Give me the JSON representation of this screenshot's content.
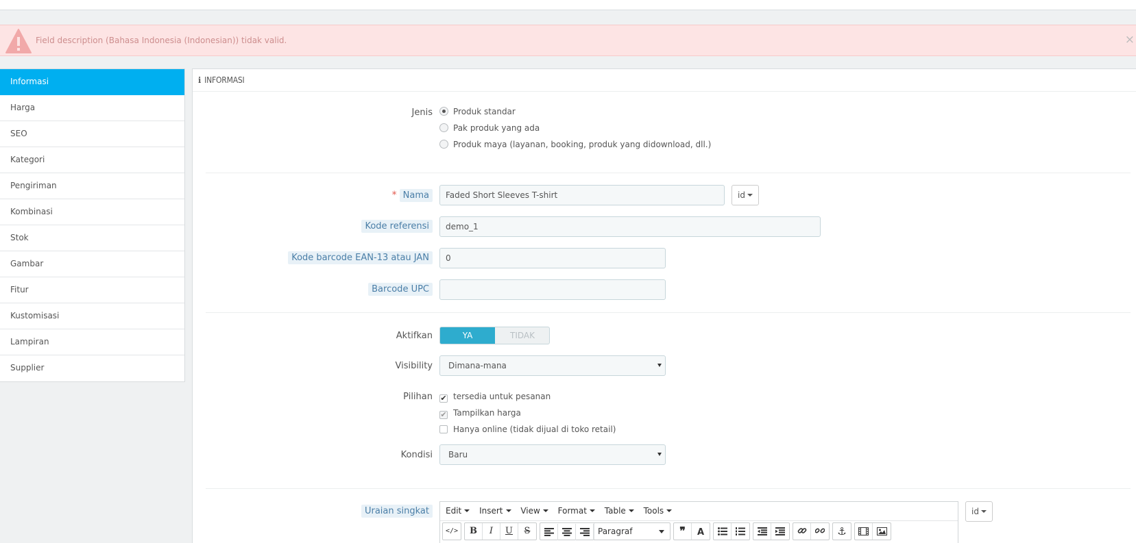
{
  "alert": {
    "message": "Field description (Bahasa Indonesia (Indonesian)) tidak valid.",
    "close": "×"
  },
  "sidebar": {
    "items": [
      {
        "label": "Informasi"
      },
      {
        "label": "Harga"
      },
      {
        "label": "SEO"
      },
      {
        "label": "Kategori"
      },
      {
        "label": "Pengiriman"
      },
      {
        "label": "Kombinasi"
      },
      {
        "label": "Stok"
      },
      {
        "label": "Gambar"
      },
      {
        "label": "Fitur"
      },
      {
        "label": "Kustomisasi"
      },
      {
        "label": "Lampiran"
      },
      {
        "label": "Supplier"
      }
    ],
    "active_index": 0
  },
  "panel": {
    "icon": "ℹ",
    "title": "INFORMASI"
  },
  "form": {
    "jenis": {
      "label": "Jenis",
      "options": [
        "Produk standar",
        "Pak produk yang ada",
        "Produk maya (layanan, booking, produk yang didownload, dll.)"
      ],
      "selected": 0
    },
    "nama": {
      "required_mark": "*",
      "label": "Nama",
      "value": "Faded Short Sleeves T-shirt",
      "lang": "id"
    },
    "kode_referensi": {
      "label": "Kode referensi",
      "value": "demo_1"
    },
    "ean13": {
      "label": "Kode barcode EAN-13 atau JAN",
      "value": "0"
    },
    "upc": {
      "label": "Barcode UPC",
      "value": ""
    },
    "aktifkan": {
      "label": "Aktifkan",
      "yes": "YA",
      "no": "TIDAK",
      "value": true
    },
    "visibility": {
      "label": "Visibility",
      "value": "Dimana-mana"
    },
    "pilihan": {
      "label": "Pilihan",
      "options": [
        {
          "label": "tersedia untuk pesanan",
          "checked": true
        },
        {
          "label": "Tampilkan harga",
          "checked": true
        },
        {
          "label": "Hanya online (tidak dijual di toko retail)",
          "checked": false
        }
      ]
    },
    "kondisi": {
      "label": "Kondisi",
      "value": "Baru"
    },
    "uraian_singkat": {
      "label": "Uraian singkat",
      "lang": "id"
    }
  },
  "editor": {
    "menus": [
      "Edit",
      "Insert",
      "View",
      "Format",
      "Table",
      "Tools"
    ],
    "format_select": "Paragraf"
  },
  "colors": {
    "accent": "#00aff0",
    "switch_on": "#2eacce",
    "alert_bg": "#fde4e4",
    "alert_text": "#cd8e8e"
  }
}
